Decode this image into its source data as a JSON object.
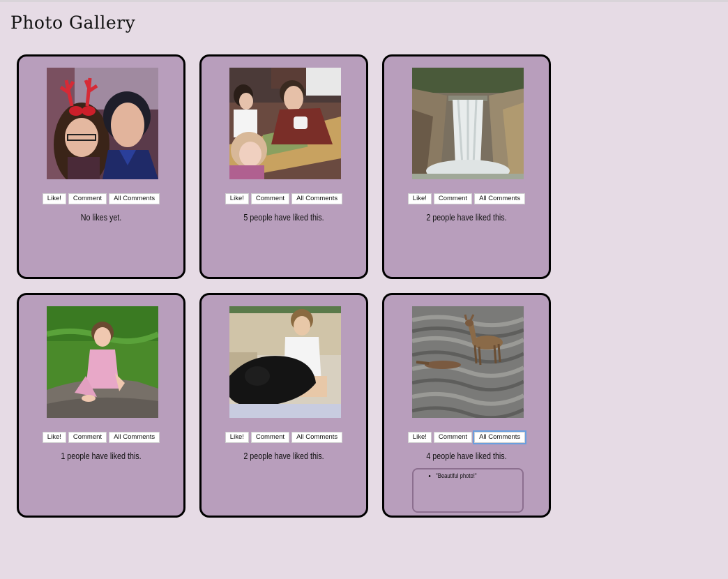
{
  "page": {
    "title": "Photo Gallery"
  },
  "buttons": {
    "like": "Like!",
    "comment": "Comment",
    "all_comments": "All Comments"
  },
  "photos": [
    {
      "subject": "couple-selfie-with-reindeer-antlers",
      "likes_text": "No likes yet."
    },
    {
      "subject": "family-playing-board-game",
      "likes_text": "5 people have liked this."
    },
    {
      "subject": "waterfall-canyon",
      "likes_text": "2 people have liked this."
    },
    {
      "subject": "little-girl-on-rock-in-grass",
      "likes_text": "1 people have liked this."
    },
    {
      "subject": "child-with-black-dog",
      "likes_text": "2 people have liked this."
    },
    {
      "subject": "deer-in-river",
      "likes_text": "4 people have liked this.",
      "comments": [
        "\"Beautiful photo!\""
      ]
    }
  ],
  "colors": {
    "background": "#e6dbe5",
    "card": "#b89ebc",
    "card_border": "#000000",
    "focus": "#6a9fdf"
  }
}
